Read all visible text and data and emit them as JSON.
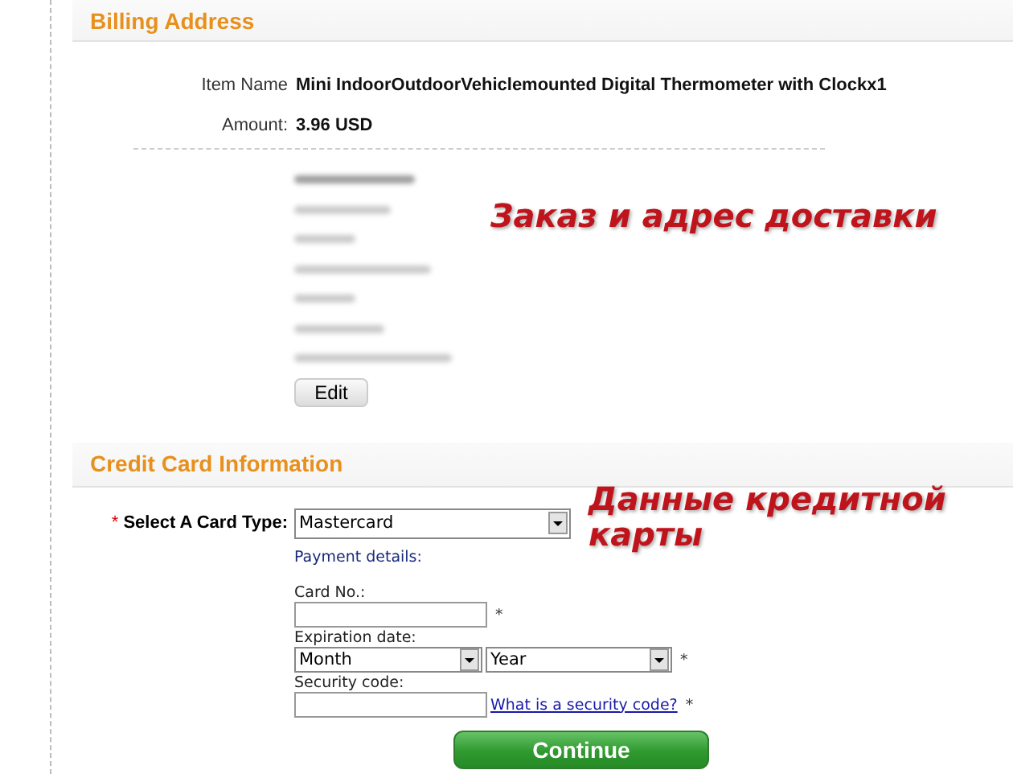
{
  "billing": {
    "title": "Billing Address",
    "rows": [
      {
        "label": "Item Name",
        "value": "Mini IndoorOutdoorVehiclemounted Digital Thermometer with Clockx1"
      },
      {
        "label": "Amount:",
        "value": "3.96 USD"
      }
    ],
    "edit_button": "Edit"
  },
  "credit_card": {
    "title": "Credit Card Information",
    "card_type": {
      "required_mark": "*",
      "label": "Select A Card Type:",
      "value": "Mastercard"
    },
    "payment_details": "Payment details:",
    "card_no": {
      "label": "Card No.:",
      "required_mark": "*"
    },
    "expiration": {
      "label": "Expiration date:",
      "month": "Month",
      "year": "Year",
      "required_mark": "*"
    },
    "security": {
      "label": "Security code:",
      "link": "What is a security code?",
      "required_mark": "*"
    },
    "continue_button": "Continue"
  },
  "annotations": [
    "Заказ и адрес доставки",
    "Данные кредитной карты"
  ]
}
